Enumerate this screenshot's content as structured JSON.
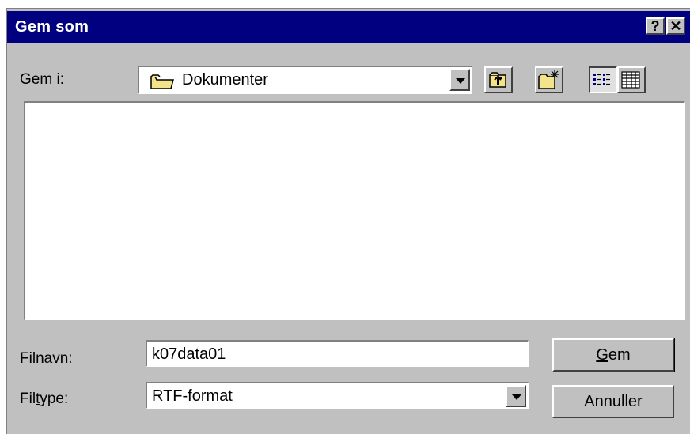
{
  "dialog": {
    "title": "Gem som",
    "help_glyph": "?",
    "close_glyph": "✕"
  },
  "lookin": {
    "label_pre": "Ge",
    "label_ul": "m",
    "label_post": " i:",
    "value": "Dokumenter",
    "icon": "folder-icon"
  },
  "toolbar": {
    "icons": [
      "up-folder-icon",
      "new-folder-icon",
      "list-view-icon",
      "details-view-icon"
    ]
  },
  "filename": {
    "label_pre": "Fil",
    "label_ul": "n",
    "label_post": "avn:",
    "value": "k07data01"
  },
  "filetype": {
    "label_pre": "Fil",
    "label_ul": "t",
    "label_post": "ype:",
    "value": "RTF-format"
  },
  "buttons": {
    "save_ul": "G",
    "save_rest": "em",
    "cancel": "Annuller"
  }
}
